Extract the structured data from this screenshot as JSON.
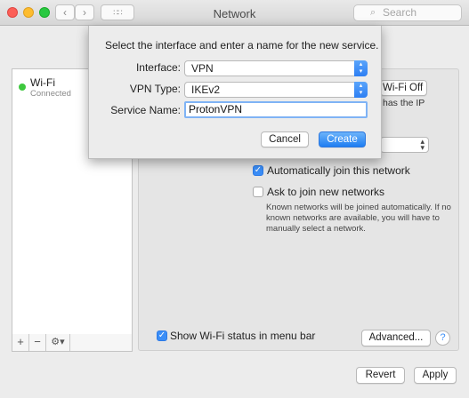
{
  "window": {
    "title": "Network",
    "search_placeholder": "Search",
    "back_glyph": "‹",
    "forward_glyph": "›",
    "grid_glyph": "∷∷"
  },
  "sidebar": {
    "items": [
      {
        "name": "Wi-Fi",
        "status": "Connected",
        "status_color": "#3ec83e"
      }
    ],
    "tools": {
      "add": "+",
      "remove": "−",
      "gear": "⚙▾"
    }
  },
  "panel": {
    "wifi_off_label": "Wi-Fi Off",
    "ip_text": "has the IP",
    "auto_join_label": "Automatically join this network",
    "auto_join_checked": true,
    "ask_join_label": "Ask to join new networks",
    "ask_join_checked": false,
    "ask_join_note": "Known networks will be joined automatically. If no known networks are available, you will have to manually select a network.",
    "show_status_label": "Show Wi-Fi status in menu bar",
    "show_status_checked": true,
    "advanced_label": "Advanced...",
    "help_label": "?"
  },
  "footer": {
    "revert_label": "Revert",
    "apply_label": "Apply"
  },
  "sheet": {
    "message": "Select the interface and enter a name for the new service.",
    "interface_label": "Interface:",
    "interface_value": "VPN",
    "vpn_type_label": "VPN Type:",
    "vpn_type_value": "IKEv2",
    "service_name_label": "Service Name:",
    "service_name_value": "ProtonVPN",
    "cancel_label": "Cancel",
    "create_label": "Create"
  },
  "colors": {
    "accent": "#3b8ef7",
    "connected": "#3ec83e"
  }
}
